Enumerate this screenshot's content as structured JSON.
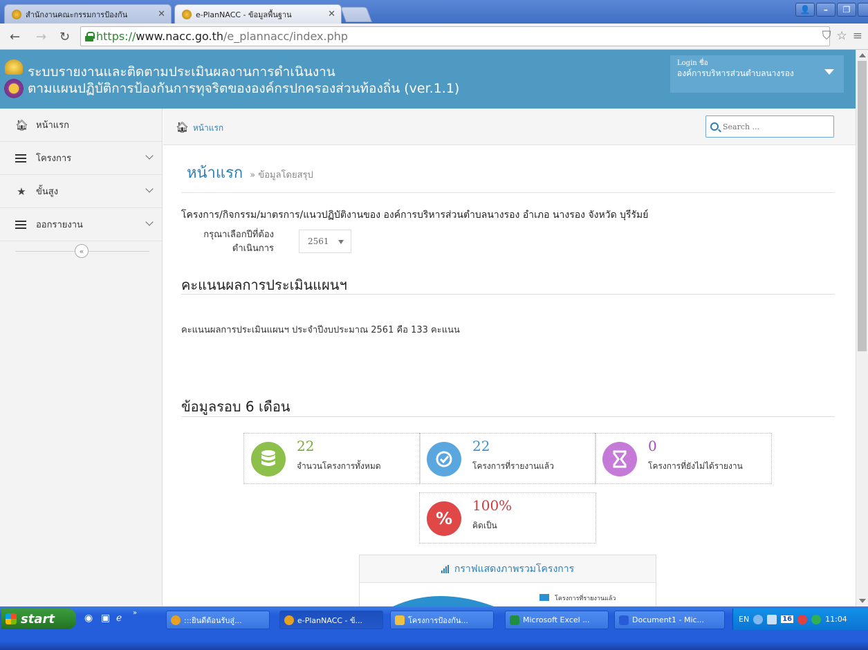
{
  "browser": {
    "tabs": [
      {
        "label": "สำนักงานคณะกรรมการป้องกัน",
        "active": false
      },
      {
        "label": "e-PlanNACC - ข้อมูลพื้นฐาน",
        "active": true
      }
    ],
    "url": {
      "scheme": "https://",
      "host": "www.nacc.go.th",
      "path": "/e_plannacc/index.php"
    }
  },
  "header": {
    "title_line1": "ระบบรายงานและติดตามประเมินผลงานการดำเนินงาน",
    "title_line2": "ตามแผนปฏิบัติการป้องกันการทุจริตขององค์กรปกครองส่วนท้องถิ่น (ver.1.1)",
    "login_label": "Login ชื่อ",
    "login_org": "องค์การบริหารส่วนตำบลนางรอง"
  },
  "sidebar": {
    "items": [
      {
        "label": "หน้าแรก",
        "icon": "home-icon"
      },
      {
        "label": "โครงการ",
        "icon": "list-icon"
      },
      {
        "label": "ขั้นสูง",
        "icon": "star-icon"
      },
      {
        "label": "ออกรายงาน",
        "icon": "list-icon"
      }
    ],
    "collapse_symbol": "«"
  },
  "breadcrumb": {
    "label": "หน้าแรก"
  },
  "search": {
    "placeholder": "Search ..."
  },
  "main": {
    "page_title": "หน้าแรก",
    "page_subtitle": "» ข้อมูลโดยสรุป",
    "project_line": "โครงการ/กิจกรรม/มาตรการ/แนวปฏิบัติงานของ องค์การบริหารส่วนตำบลนางรอง อำเภอ นางรอง จังหวัด บุรีรัมย์",
    "year_label_1": "กรุณาเลือกปีที่ต้อง",
    "year_label_2": "ดำเนินการ",
    "year_value": "2561",
    "score_title": "คะแนนผลการประเมินแผนฯ",
    "score_text": "คะแนนผลการประเมินแผนฯ ประจำปีงบประมาณ 2561 คือ 133 คะแนน",
    "six_month_title": "ข้อมูลรอบ 6 เดือน",
    "stats": [
      {
        "value": "22",
        "label": "จำนวนโครงการทั้งหมด",
        "color": "#8cc04b",
        "num_color": "#7aa83a",
        "icon": "database-icon"
      },
      {
        "value": "22",
        "label": "โครงการที่รายงานแล้ว",
        "color": "#5aa7e0",
        "num_color": "#3a8fd0",
        "icon": "check-circle-icon"
      },
      {
        "value": "0",
        "label": "โครงการที่ยังไม่ได้รายงาน",
        "color": "#c47ad6",
        "num_color": "#a24fbe",
        "icon": "hourglass-icon"
      },
      {
        "value": "100%",
        "label": "คิดเป็น",
        "color": "#e04848",
        "num_color": "#d03b3b",
        "icon": "percent-icon"
      }
    ],
    "chart_panel_title": "กราฟแสดงภาพรวมโครงการ",
    "chart_legend": "โครงการที่รายงานแล้ว"
  },
  "taskbar": {
    "start_label": "start",
    "tasks": [
      {
        "label": ":::ยินดีต้อนรับสู่...",
        "color": "#e8a020"
      },
      {
        "label": "e-PlanNACC - ข้...",
        "color": "#e8a020",
        "active": true
      },
      {
        "label": "โครงการป้องกัน...",
        "color": "#f0c040"
      },
      {
        "label": "Microsoft Excel ...",
        "color": "#1f8f3f"
      },
      {
        "label": "Document1 - Mic...",
        "color": "#2a5bd7"
      }
    ],
    "tray_lang": "EN",
    "tray_badge": "16",
    "clock": "11:04"
  }
}
